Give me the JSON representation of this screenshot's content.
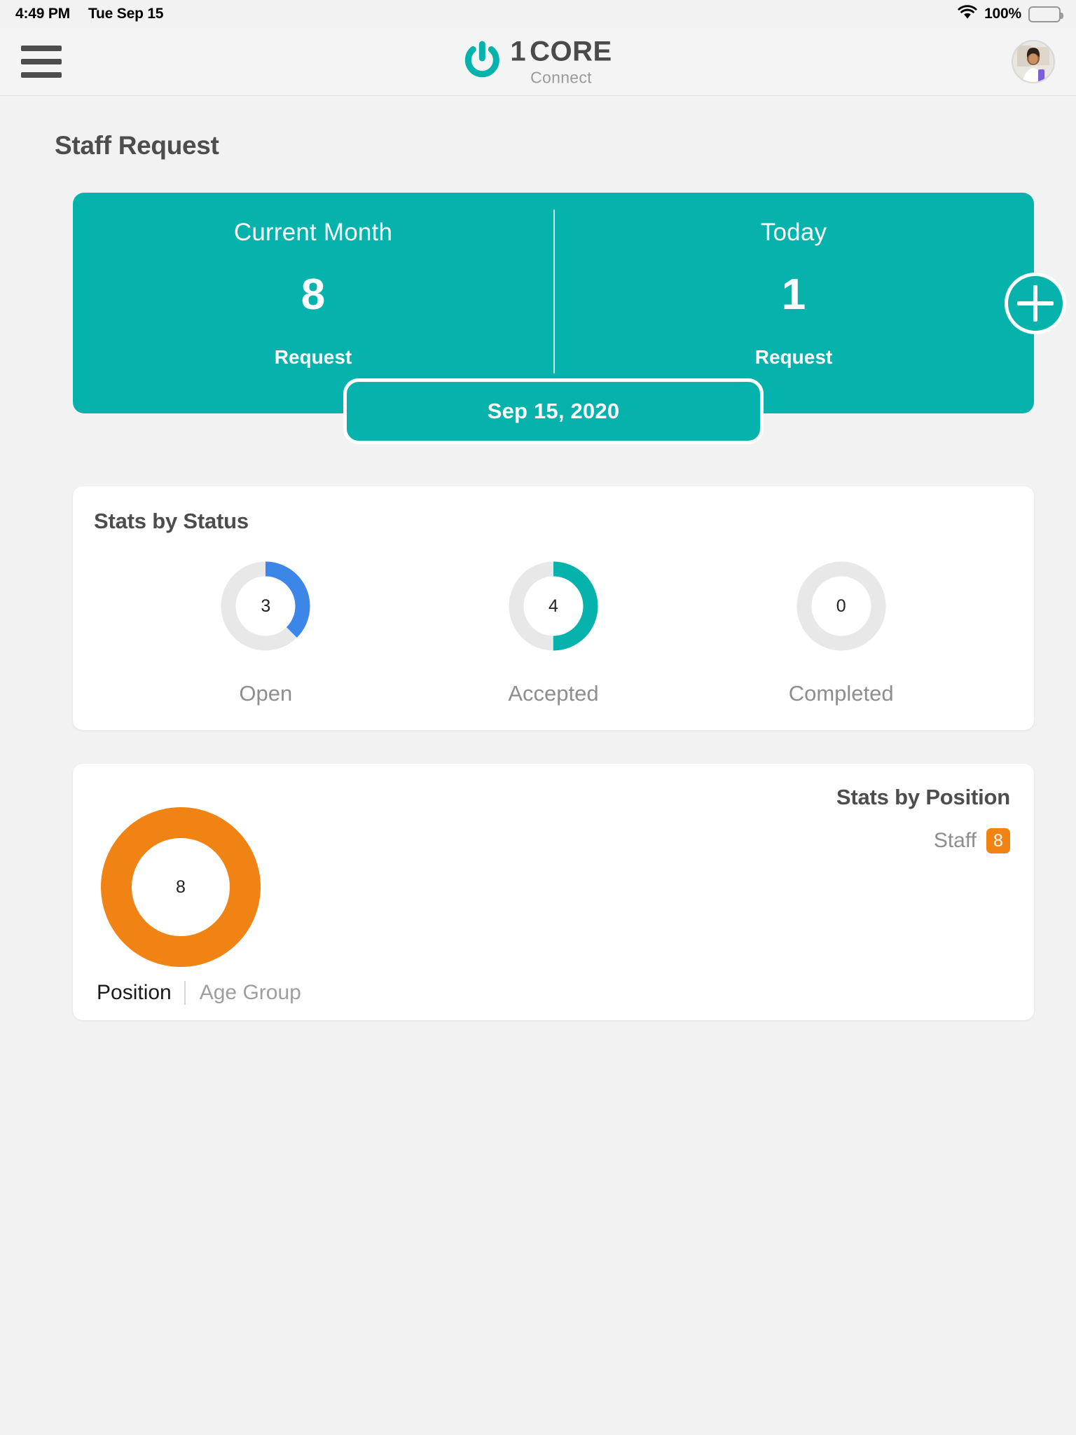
{
  "status_bar": {
    "time": "4:49 PM",
    "date": "Tue Sep 15",
    "battery_percent": "100%",
    "wifi_icon": "wifi-icon",
    "battery_icon": "battery-full-icon"
  },
  "header": {
    "menu_icon": "hamburger-menu-icon",
    "brand_one": "1",
    "brand_core": "CORE",
    "brand_sub": "Connect",
    "logo_icon": "power-button-logo-icon",
    "avatar_icon": "user-avatar"
  },
  "page": {
    "title": "Staff Request"
  },
  "summary": {
    "month_label": "Current Month",
    "month_value": "8",
    "month_unit": "Request",
    "today_label": "Today",
    "today_value": "1",
    "today_unit": "Request",
    "date_pill": "Sep 15, 2020",
    "add_icon": "plus-icon"
  },
  "status_section": {
    "title": "Stats by Status"
  },
  "position_section": {
    "title": "Stats by Position",
    "legend_label": "Staff",
    "legend_value": "8",
    "center_value": "8",
    "tab_active": "Position",
    "tab_inactive": "Age Group"
  },
  "colors": {
    "teal": "#05B2AC",
    "blue": "#3C86E8",
    "orange": "#F08313",
    "track": "#E8E8E8",
    "page_bg": "#F2F2F2"
  },
  "chart_data": [
    {
      "type": "pie",
      "title": "Stats by Status",
      "subtype": "donut-gauges",
      "total": 8,
      "categories": [
        "Open",
        "Accepted",
        "Completed"
      ],
      "values": [
        3,
        4,
        0
      ],
      "fractions": [
        0.375,
        0.5,
        0.0
      ],
      "colors": [
        "#3C86E8",
        "#05B2AC",
        "#E8E8E8"
      ],
      "track_color": "#E8E8E8",
      "center_labels": [
        "3",
        "4",
        "0"
      ],
      "legend": "below-each",
      "grid": false
    },
    {
      "type": "pie",
      "title": "Stats by Position",
      "subtype": "donut",
      "total": 8,
      "categories": [
        "Staff"
      ],
      "values": [
        8
      ],
      "fractions": [
        1.0
      ],
      "colors": [
        "#F08313"
      ],
      "center_label": "8",
      "legend": "top-right",
      "legend_entries": [
        {
          "name": "Staff",
          "value": 8,
          "color": "#F08313"
        }
      ],
      "grid": false
    }
  ]
}
